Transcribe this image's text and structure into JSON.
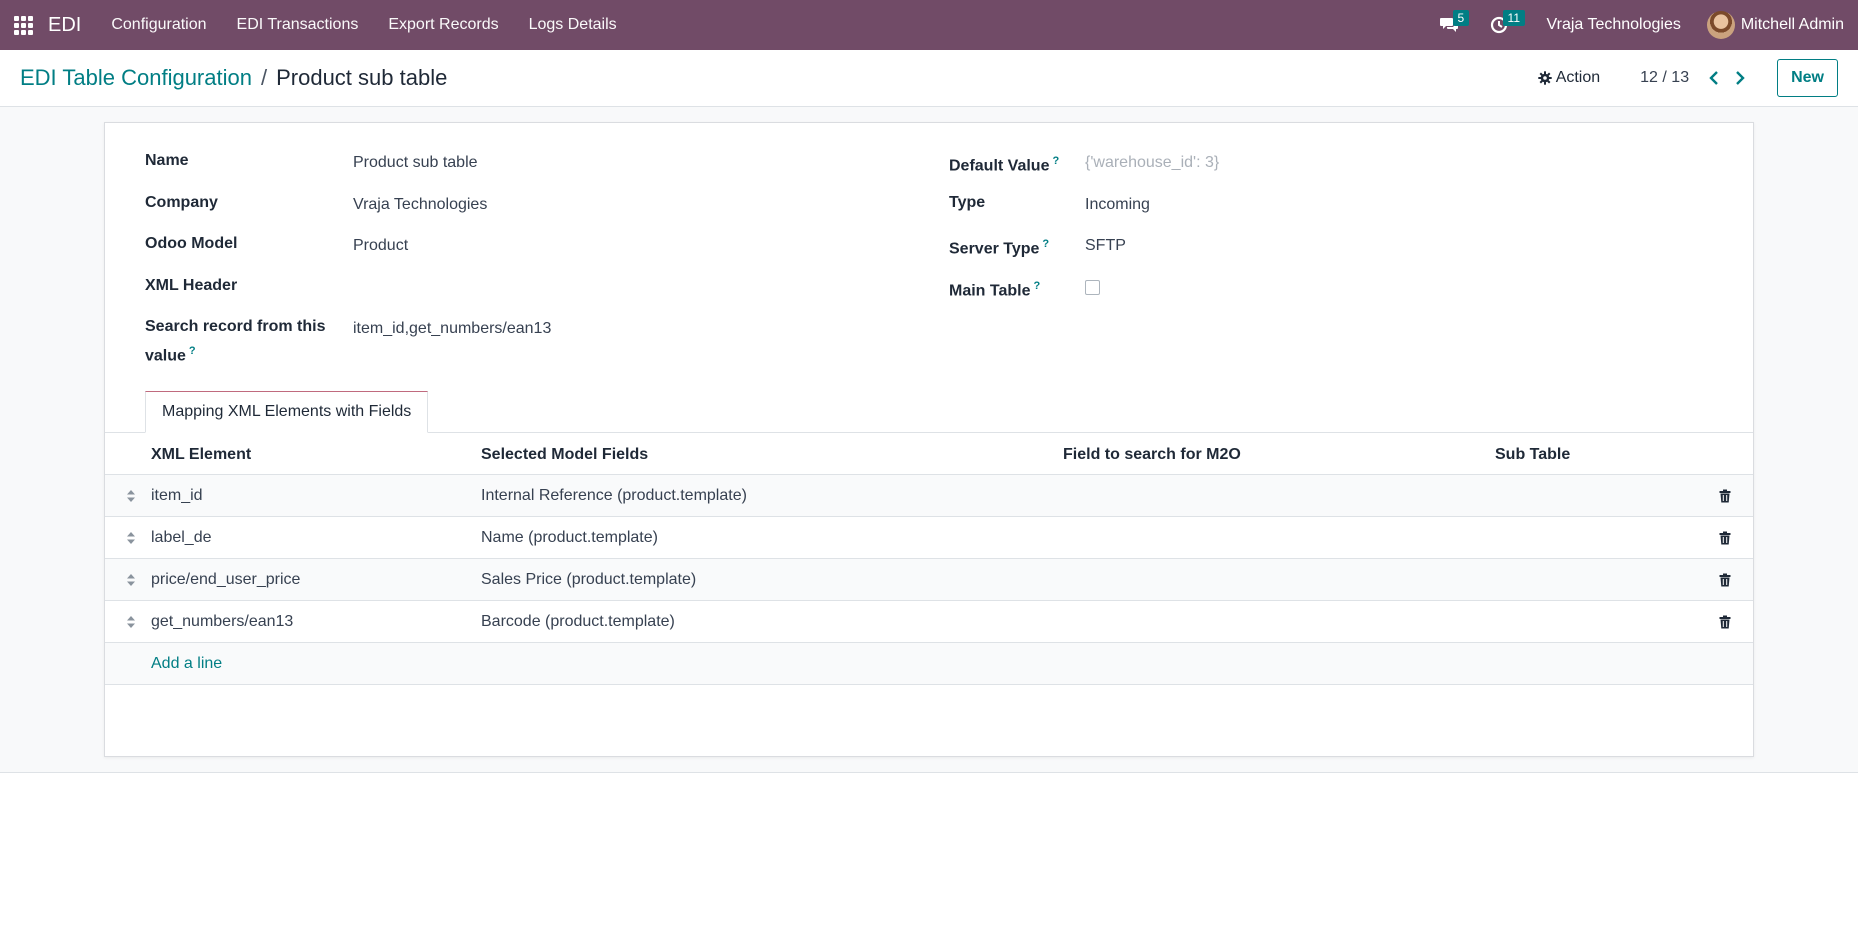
{
  "navbar": {
    "app_name": "EDI",
    "menu": [
      "Configuration",
      "EDI Transactions",
      "Export Records",
      "Logs Details"
    ],
    "messages_count": "5",
    "activities_count": "11",
    "company": "Vraja Technologies",
    "user": "Mitchell Admin"
  },
  "breadcrumb": {
    "parent": "EDI Table Configuration",
    "separator": "/",
    "current": "Product sub table"
  },
  "control": {
    "action_label": "Action",
    "pager": "12 / 13",
    "new_label": "New"
  },
  "form": {
    "left": [
      {
        "label": "Name",
        "value": "Product sub table"
      },
      {
        "label": "Company",
        "value": "Vraja Technologies"
      },
      {
        "label": "Odoo Model",
        "value": "Product"
      },
      {
        "label": "XML Header",
        "value": ""
      },
      {
        "label": "Search record from this value",
        "value": "item_id,get_numbers/ean13",
        "help": "?"
      }
    ],
    "right": {
      "default_value_label": "Default Value",
      "default_value_placeholder": "{'warehouse_id': 3}",
      "type_label": "Type",
      "type_value": "Incoming",
      "server_type_label": "Server Type",
      "server_type_value": "SFTP",
      "main_table_label": "Main Table",
      "main_table_checked": false,
      "help": "?"
    }
  },
  "tab": {
    "label": "Mapping XML Elements with Fields"
  },
  "table": {
    "headers": [
      "XML Element",
      "Selected Model Fields",
      "Field to search for M2O",
      "Sub Table"
    ],
    "rows": [
      {
        "xml_element": "item_id",
        "model_field": "Internal Reference (product.template)",
        "m2o_field": "",
        "sub_table": ""
      },
      {
        "xml_element": "label_de",
        "model_field": "Name (product.template)",
        "m2o_field": "",
        "sub_table": ""
      },
      {
        "xml_element": "price/end_user_price",
        "model_field": "Sales Price (product.template)",
        "m2o_field": "",
        "sub_table": ""
      },
      {
        "xml_element": "get_numbers/ean13",
        "model_field": "Barcode (product.template)",
        "m2o_field": "",
        "sub_table": ""
      }
    ],
    "add_line": "Add a line"
  },
  "colors": {
    "navbar": "#714b67",
    "accent": "#017e84"
  }
}
